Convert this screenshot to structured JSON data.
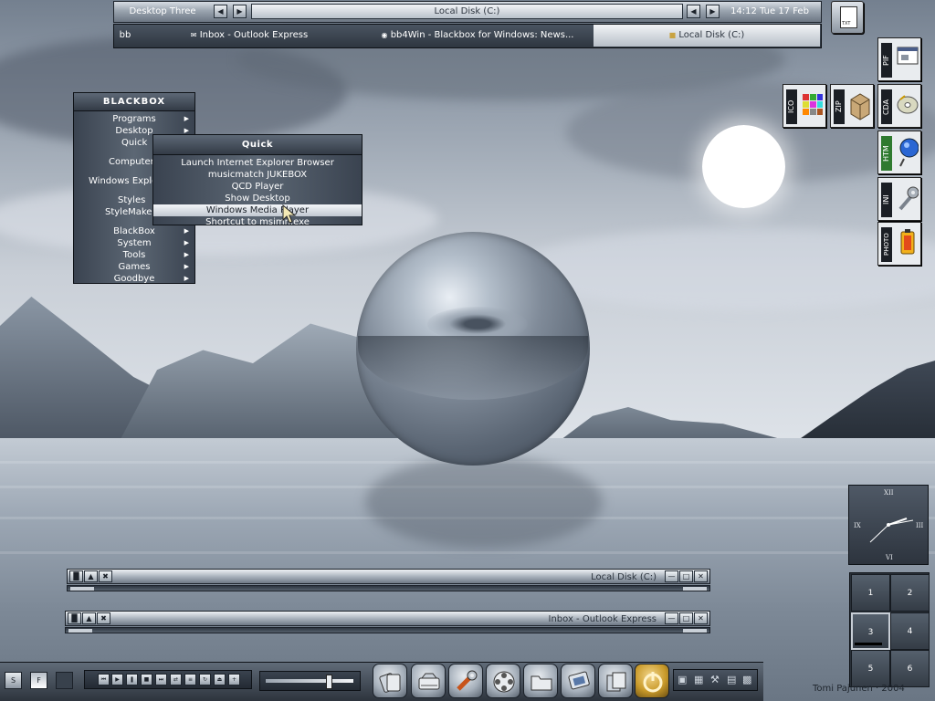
{
  "toolbar": {
    "workspace": "Desktop Three",
    "window_label": "Local Disk (C:)",
    "clock": "14:12 Tue 17 Feb",
    "bb_label": "bb",
    "tasks": [
      {
        "label": "Inbox - Outlook Express"
      },
      {
        "label": "bb4Win - Blackbox for Windows: News..."
      },
      {
        "label": "Local Disk (C:)"
      }
    ]
  },
  "main_menu": {
    "title": "BLACKBOX",
    "items": [
      {
        "label": "Programs"
      },
      {
        "label": "Desktop"
      },
      {
        "label": "Quick"
      },
      {
        "label": "Computer"
      },
      {
        "label": "Windows Explorer"
      },
      {
        "label": "Styles"
      },
      {
        "label": "StyleMaker"
      },
      {
        "label": "BlackBox"
      },
      {
        "label": "System"
      },
      {
        "label": "Tools"
      },
      {
        "label": "Games"
      },
      {
        "label": "Goodbye"
      }
    ]
  },
  "quick_menu": {
    "title": "Quick",
    "items": [
      {
        "label": "Launch Internet Explorer Browser"
      },
      {
        "label": "musicmatch JUKEBOX"
      },
      {
        "label": "QCD Player"
      },
      {
        "label": "Show Desktop"
      },
      {
        "label": "Windows Media Player"
      },
      {
        "label": "Shortcut to msimn.exe"
      }
    ],
    "highlighted_index": 4
  },
  "file_icons": {
    "txt": "TXT",
    "pif": "PIF",
    "ico": "ICO",
    "zip": "ZIP",
    "cda": "CDA",
    "htm": "HTM",
    "ini": "INI",
    "photo": "PHOTO"
  },
  "windows": [
    {
      "title": "Local Disk (C:)"
    },
    {
      "title": "Inbox - Outlook Express"
    }
  ],
  "clock_widget": {
    "numerals": {
      "xii": "XII",
      "iii": "III",
      "vi": "VI",
      "ix": "IX"
    }
  },
  "pager": {
    "desktops": [
      "1",
      "2",
      "3",
      "4",
      "5",
      "6"
    ],
    "active": "3"
  },
  "bottom_bar": {
    "s_label": "S",
    "f_label": "F"
  },
  "credit": "Tomi Pajunen · 2004",
  "colors": {
    "accent": "#5c6774",
    "highlight": "#f4f6f9",
    "dark": "#2e3640"
  }
}
